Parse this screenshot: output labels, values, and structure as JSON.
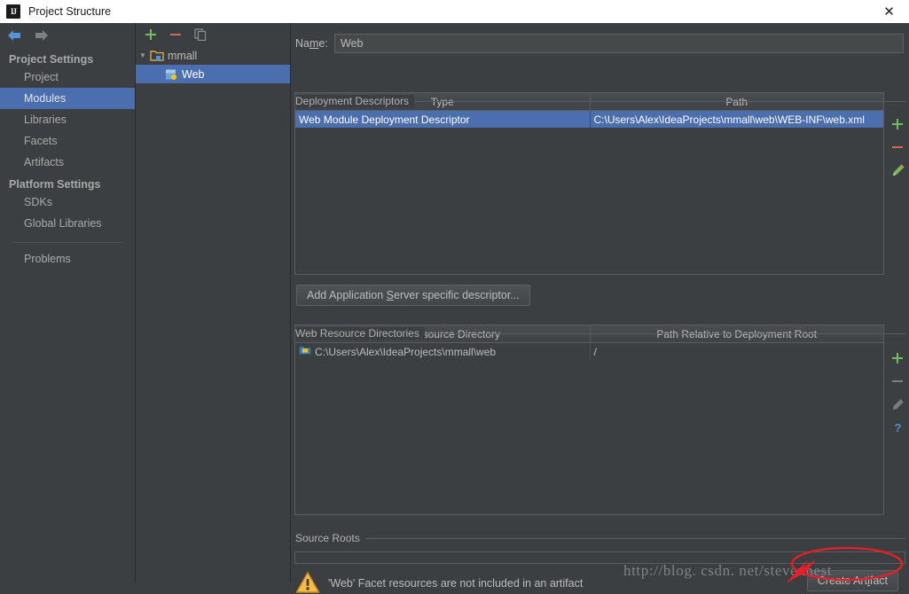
{
  "window": {
    "title": "Project Structure",
    "app_icon": "intellij-idea-icon",
    "close_label": "✕"
  },
  "colors": {
    "accent_selection": "#4b6eaf",
    "panel_bg": "#3c3f41",
    "border": "#5a5d5e",
    "add_green": "#6fbf5b",
    "remove_red": "#d2684f",
    "help_blue": "#5394d6",
    "warning_amber": "#f0b429",
    "focus_blue": "#3592c4",
    "annotation_red": "#ee1c25"
  },
  "sidebar": {
    "back_label": "Back",
    "forward_label": "Forward",
    "groups": [
      {
        "title": "Project Settings",
        "items": [
          {
            "label": "Project",
            "selected": false
          },
          {
            "label": "Modules",
            "selected": true
          },
          {
            "label": "Libraries",
            "selected": false
          },
          {
            "label": "Facets",
            "selected": false
          },
          {
            "label": "Artifacts",
            "selected": false
          }
        ]
      },
      {
        "title": "Platform Settings",
        "items": [
          {
            "label": "SDKs",
            "selected": false
          },
          {
            "label": "Global Libraries",
            "selected": false
          }
        ]
      }
    ],
    "footer_items": [
      {
        "label": "Problems",
        "selected": false
      }
    ]
  },
  "tree_panel": {
    "toolbar": [
      {
        "name": "add-module-button",
        "glyph": "+"
      },
      {
        "name": "remove-module-button",
        "glyph": "−"
      },
      {
        "name": "copy-module-button",
        "glyph": "copy"
      }
    ],
    "nodes": [
      {
        "label": "mmall",
        "icon": "module-folder-icon",
        "expanded": true,
        "depth": 0,
        "selected": false
      },
      {
        "label": "Web",
        "icon": "web-facet-icon",
        "expanded": false,
        "depth": 1,
        "selected": true
      }
    ]
  },
  "main": {
    "name_field": {
      "label_pre": "Na",
      "label_mnemonic": "m",
      "label_post": "e:",
      "value": "Web",
      "placeholder": ""
    },
    "deployment_descriptors": {
      "title": "Deployment Descriptors",
      "columns": [
        "Type",
        "Path"
      ],
      "rows": [
        {
          "type": "Web Module Deployment Descriptor",
          "path": "C:\\Users\\Alex\\IdeaProjects\\mmall\\web\\WEB-INF\\web.xml",
          "selected": true
        }
      ],
      "toolbar": [
        {
          "name": "add-descriptor-button",
          "glyph": "+",
          "enabled": true
        },
        {
          "name": "remove-descriptor-button",
          "glyph": "−",
          "enabled": true
        },
        {
          "name": "edit-descriptor-button",
          "glyph": "pencil",
          "enabled": true
        }
      ],
      "add_button_label_pre": "Add Application ",
      "add_button_mnemonic": "S",
      "add_button_label_post": "erver specific descriptor..."
    },
    "web_resource_directories": {
      "title": "Web Resource Directories",
      "columns": [
        "Web Resource Directory",
        "Path Relative to Deployment Root"
      ],
      "rows": [
        {
          "directory": "C:\\Users\\Alex\\IdeaProjects\\mmall\\web",
          "icon": "folder-web-icon",
          "relative_path": "/"
        }
      ],
      "toolbar": [
        {
          "name": "add-web-resource-button",
          "glyph": "+",
          "enabled": true
        },
        {
          "name": "remove-web-resource-button",
          "glyph": "−",
          "enabled": false
        },
        {
          "name": "edit-web-resource-button",
          "glyph": "pencil",
          "enabled": false
        },
        {
          "name": "help-button",
          "glyph": "?",
          "enabled": true
        }
      ]
    },
    "source_roots": {
      "title": "Source Roots",
      "rows": []
    },
    "warning": {
      "icon": "warning-triangle-icon",
      "message": "'Web' Facet resources are not included in an artifact",
      "action_label_pre": "Create Art",
      "action_mnemonic": "i",
      "action_label_post": "fact"
    }
  },
  "overlay": {
    "watermark": "http://blog. csdn. net/stevennest",
    "annotation_shapes": [
      "red-ellipse",
      "red-arrow"
    ]
  }
}
